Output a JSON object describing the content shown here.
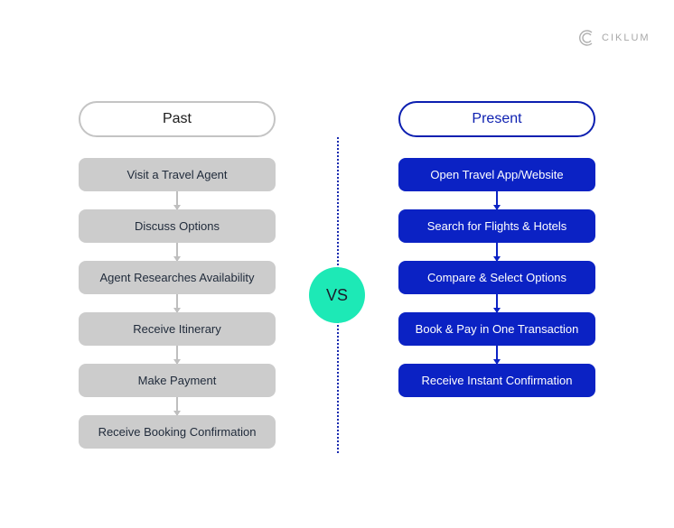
{
  "brand": {
    "logo_text": "CIKLUM",
    "logo_icon": "ciklum-c-icon"
  },
  "past": {
    "title": "Past",
    "steps": [
      "Visit a Travel Agent",
      "Discuss Options",
      "Agent Researches Availability",
      "Receive Itinerary",
      "Make Payment",
      "Receive Booking Confirmation"
    ]
  },
  "present": {
    "title": "Present",
    "steps": [
      "Open Travel App/Website",
      "Search for Flights & Hotels",
      "Compare & Select Options",
      "Book & Pay in One Transaction",
      "Receive Instant Confirmation"
    ]
  },
  "vs_label": "VS",
  "colors": {
    "past_box": "#cccccc",
    "present_box": "#0b22c4",
    "vs_circle": "#1de9b6",
    "divider": "#1a2bb0"
  }
}
